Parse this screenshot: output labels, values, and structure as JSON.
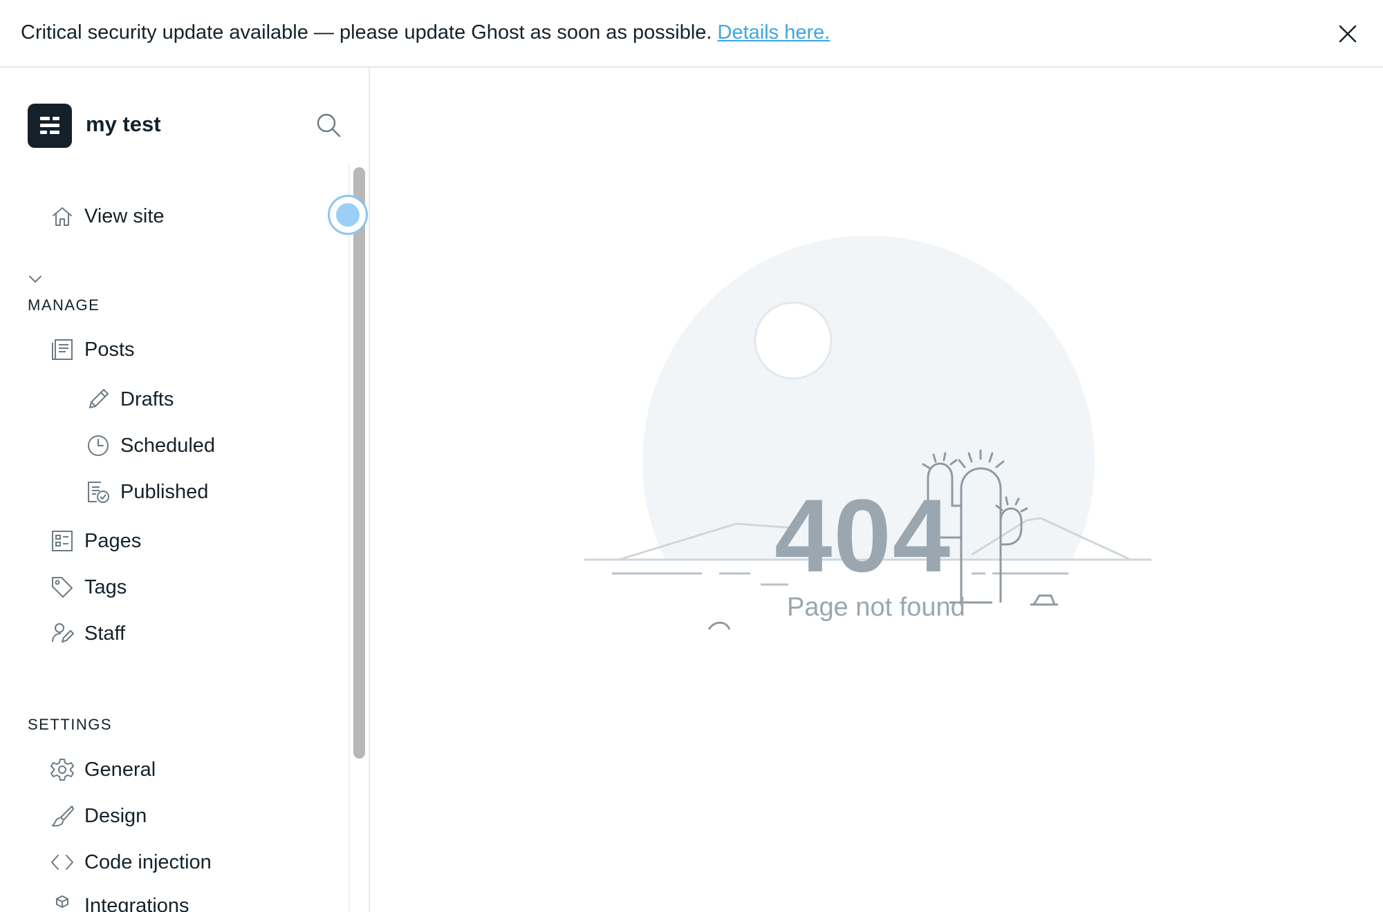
{
  "banner": {
    "message": "Critical security update available — please update Ghost as soon as possible. ",
    "link_text": "Details here."
  },
  "sidebar": {
    "site_title": "my test",
    "view_site": "View site",
    "manage_heading": "MANAGE",
    "settings_heading": "SETTINGS",
    "manage_items": [
      {
        "label": "Posts",
        "icon": "posts-icon"
      },
      {
        "label": "Drafts",
        "icon": "pencil-icon"
      },
      {
        "label": "Scheduled",
        "icon": "clock-icon"
      },
      {
        "label": "Published",
        "icon": "published-icon"
      },
      {
        "label": "Pages",
        "icon": "pages-icon"
      },
      {
        "label": "Tags",
        "icon": "tag-icon"
      },
      {
        "label": "Staff",
        "icon": "staff-icon"
      }
    ],
    "settings_items": [
      {
        "label": "General",
        "icon": "gear-icon"
      },
      {
        "label": "Design",
        "icon": "brush-icon"
      },
      {
        "label": "Code injection",
        "icon": "code-icon"
      },
      {
        "label": "Integrations",
        "icon": "integrations-icon"
      }
    ]
  },
  "main": {
    "error_code": "404",
    "error_message": "Page not found"
  },
  "colors": {
    "text": "#15212a",
    "link": "#3ea6e0",
    "muted": "#9aa7b0",
    "illustration_bg": "#f2f5f8",
    "logo_bg": "#15212a"
  }
}
